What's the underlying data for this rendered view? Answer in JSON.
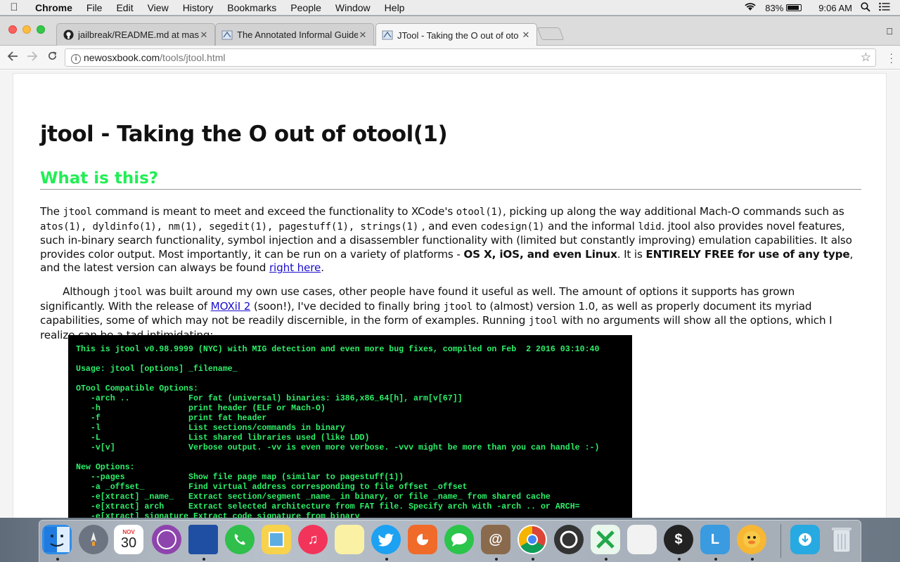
{
  "menubar": {
    "app": "Chrome",
    "items": [
      "File",
      "Edit",
      "View",
      "History",
      "Bookmarks",
      "People",
      "Window",
      "Help"
    ],
    "battery": "83%",
    "time": "9:06 AM"
  },
  "tabs": [
    {
      "title": "jailbreak/README.md at maste",
      "icon": "github-icon"
    },
    {
      "title": "The Annotated Informal Guide",
      "icon": "site-icon"
    },
    {
      "title": "JTool - Taking the O out of oto",
      "icon": "site-icon"
    }
  ],
  "address": {
    "host": "newosxbook.com",
    "path": "/tools/jtool.html"
  },
  "page": {
    "title": "jtool - Taking the O out of otool(1)",
    "section": "What is this?",
    "p1": {
      "a": "The ",
      "jtool": "jtool",
      "b": " command is meant to meet and exceed the functionality to XCode's ",
      "otool": "otool(1)",
      "c": ", picking up along the way additional Mach-O commands such as ",
      "cmds": "atos(1), dyldinfo(1), nm(1), segedit(1), pagestuff(1), strings(1)",
      "d": " , and even ",
      "codesign": "codesign(1)",
      "e": " and the informal ",
      "ldid": "ldid",
      "f": ". jtool also provides novel features, such in-binary search functionality, symbol injection and a disassembler functionality with (limited but constantly improving) emulation capabilities. It also provides color output. Most importantly, it can be run on a variety of platforms - ",
      "platforms": "OS X, iOS, and even Linux",
      "g": ". It is ",
      "free": "ENTIRELY FREE for use of any type",
      "h": ", and the latest version can always be found ",
      "link": "right here",
      "i": "."
    },
    "p2": {
      "a": "Although ",
      "jtool": "jtool",
      "b": " was built around my own use cases, other people have found it useful as well. The amount of options it supports has grown significantly. With the release of ",
      "link": "MOXiI 2",
      "c": " (soon!), I've decided to finally bring ",
      "jtool2": "jtool",
      "d": " to (almost) version 1.0, as well as properly document its myriad capabilities, some of which may not be readily discernible, in the form of examples. Running ",
      "jtool3": "jtool",
      "e": " with no arguments will show all the options, which I realize can be a tad intimidating:"
    },
    "terminal": [
      "This is jtool v0.98.9999 (NYC) with MIG detection and even more bug fixes, compiled on Feb  2 2016 03:10:40",
      "",
      "Usage: jtool [options] _filename_",
      "",
      "OTool Compatible Options:",
      "   -arch ..            For fat (universal) binaries: i386,x86_64[h], arm[v[67]]",
      "   -h                  print header (ELF or Mach-O)",
      "   -f                  print fat header",
      "   -l                  List sections/commands in binary",
      "   -L                  List shared libraries used (like LDD)",
      "   -v[v]               Verbose output. -vv is even more verbose. -vvv might be more than you can handle :-)",
      "",
      "New Options:",
      "   --pages             Show file page map (similar to pagestuff(1))",
      "   -a _offset_         Find virtual address corresponding to file offset _offset",
      "   -e[xtract] _name_   Extract section/segment _name_ in binary, or file _name_ from shared cache",
      "   -e[xtract] arch     Extract selected architecture from FAT file. Specify arch with -arch .. or ARCH=",
      "   -e[xtract] signature Extract code signature from binary"
    ]
  },
  "dock": {
    "calendar_month": "NOV",
    "calendar_day": "30",
    "items": [
      "finder",
      "launchpad",
      "calendar",
      "safari",
      "notebook",
      "facetime",
      "preview",
      "music",
      "notes",
      "twitter",
      "keynote",
      "messages",
      "contacts",
      "chrome",
      "obs",
      "excel",
      "folder",
      "terminal",
      "keynote-blue",
      "duck",
      "downloads",
      "trash"
    ]
  }
}
